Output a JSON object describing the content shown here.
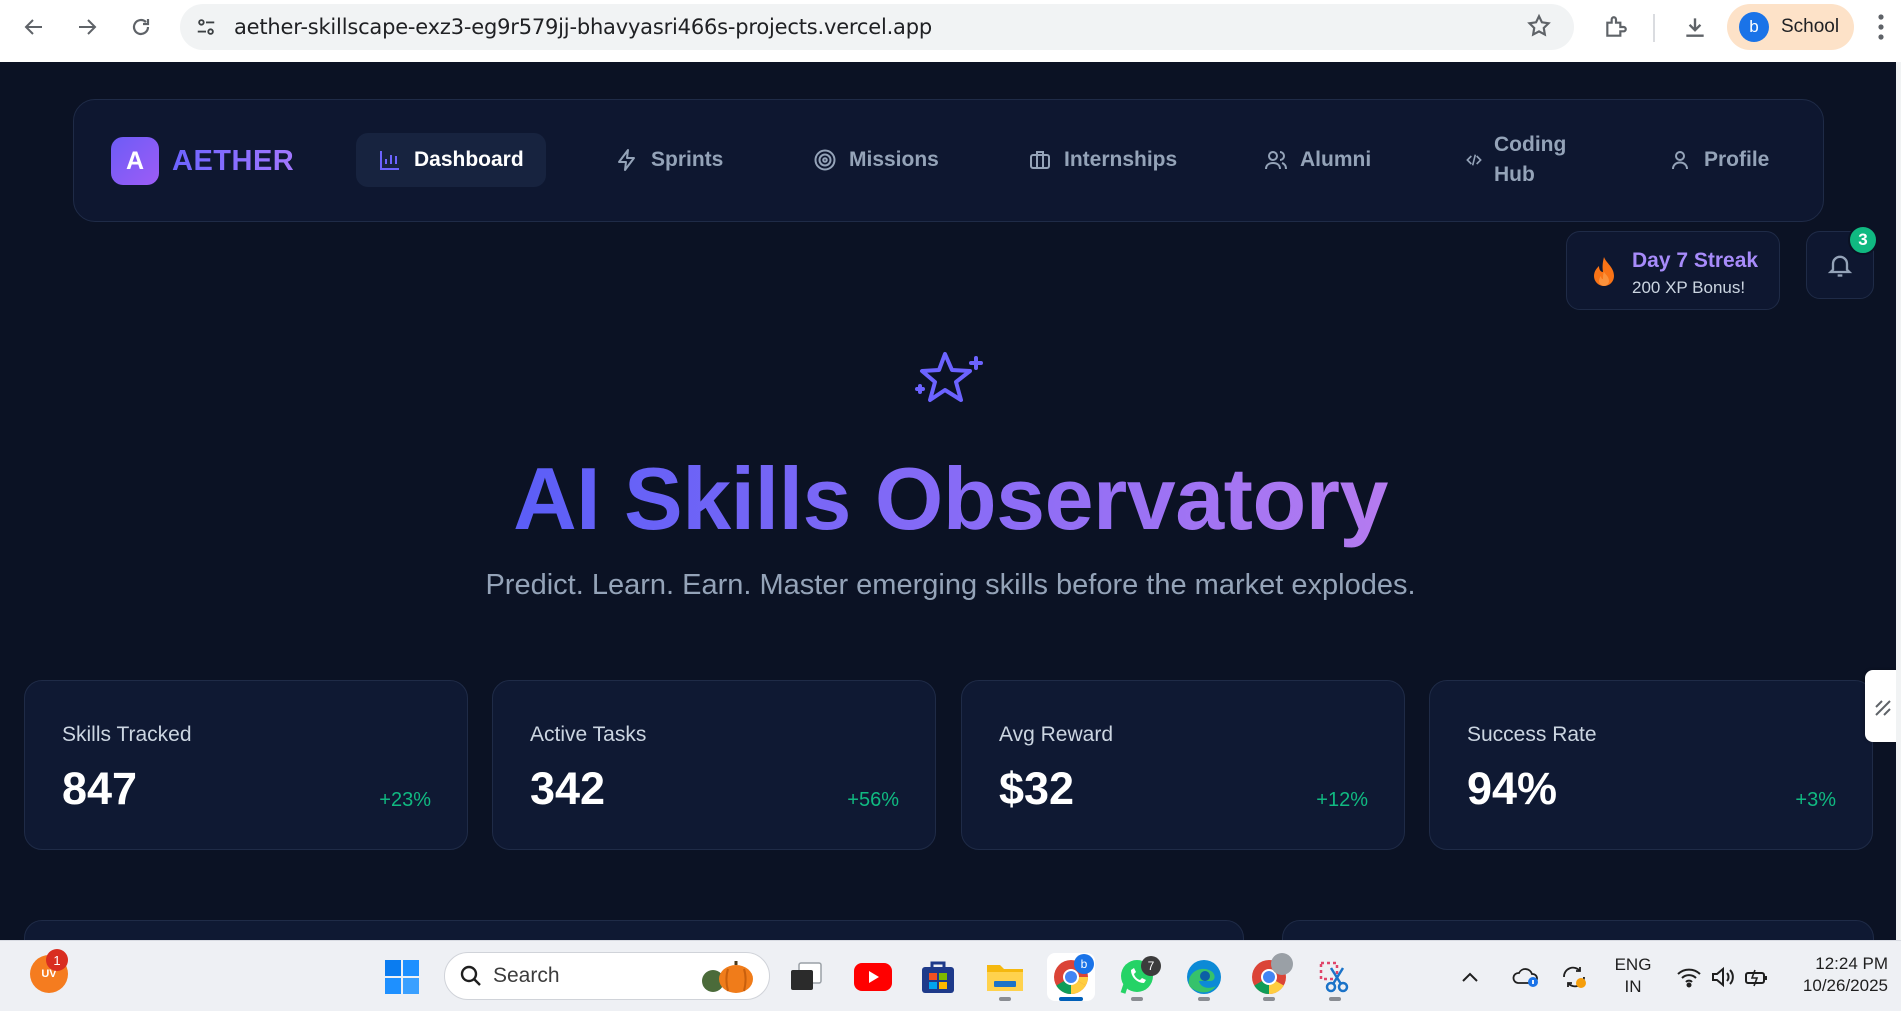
{
  "browser": {
    "url": "aether-skillscape-exz3-eg9r579jj-bhavyasri466s-projects.vercel.app",
    "profile_initial": "b",
    "profile_name": "School"
  },
  "app": {
    "logo_letter": "A",
    "brand_name": "AETHER",
    "nav": [
      {
        "label": "Dashboard",
        "icon": "bar-chart-icon",
        "active": true
      },
      {
        "label": "Sprints",
        "icon": "lightning-icon"
      },
      {
        "label": "Missions",
        "icon": "target-icon"
      },
      {
        "label": "Internships",
        "icon": "briefcase-icon"
      },
      {
        "label": "Alumni",
        "icon": "users-icon"
      },
      {
        "label": "Coding",
        "label2": "Hub",
        "icon": "code-icon"
      },
      {
        "label": "Profile",
        "icon": "user-icon"
      }
    ],
    "streak": {
      "title": "Day 7 Streak",
      "subtitle": "200 XP Bonus!"
    },
    "notifications_count": "3"
  },
  "hero": {
    "icon": "sparkles-icon",
    "title": "AI Skills Observatory",
    "subtitle": "Predict. Learn. Earn. Master emerging skills before the market explodes."
  },
  "stats": [
    {
      "label": "Skills Tracked",
      "value": "847",
      "delta": "+23%"
    },
    {
      "label": "Active Tasks",
      "value": "342",
      "delta": "+56%"
    },
    {
      "label": "Avg Reward",
      "value": "$32",
      "delta": "+12%"
    },
    {
      "label": "Success Rate",
      "value": "94%",
      "delta": "+3%"
    }
  ],
  "taskbar": {
    "weather_badge": "1",
    "weather_label": "UV",
    "search_label": "Search",
    "whatsapp_badge": "7",
    "lang_line1": "ENG",
    "lang_line2": "IN",
    "time": "12:24 PM",
    "date": "10/26/2025"
  },
  "colors": {
    "accent": "#6c63ff",
    "background": "#0b1224",
    "positive": "#10b981"
  }
}
